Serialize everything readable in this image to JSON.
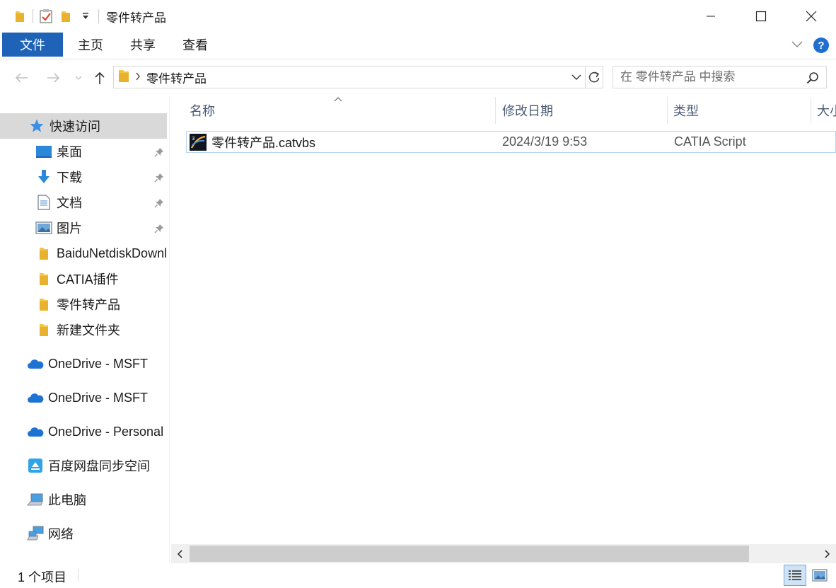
{
  "window": {
    "title": "零件转产品"
  },
  "ribbon": {
    "tabs": [
      "文件",
      "主页",
      "共享",
      "查看"
    ]
  },
  "address": {
    "breadcrumb": [
      "零件转产品"
    ],
    "search_placeholder": "在 零件转产品 中搜索"
  },
  "sidebar": {
    "items": [
      {
        "label": "快速访问",
        "icon": "star-icon"
      },
      {
        "label": "桌面",
        "icon": "desktop-icon",
        "pinned": true
      },
      {
        "label": "下载",
        "icon": "download-icon",
        "pinned": true
      },
      {
        "label": "文档",
        "icon": "document-icon",
        "pinned": true
      },
      {
        "label": "图片",
        "icon": "picture-icon",
        "pinned": true
      },
      {
        "label": "BaiduNetdiskDownload",
        "icon": "folder-icon"
      },
      {
        "label": "CATIA插件",
        "icon": "folder-icon"
      },
      {
        "label": "零件转产品",
        "icon": "folder-icon"
      },
      {
        "label": "新建文件夹",
        "icon": "folder-icon"
      },
      {
        "label": "OneDrive - MSFT",
        "icon": "onedrive-icon"
      },
      {
        "label": "OneDrive - MSFT",
        "icon": "onedrive-icon"
      },
      {
        "label": "OneDrive - Personal",
        "icon": "onedrive-icon"
      },
      {
        "label": "百度网盘同步空间",
        "icon": "baidu-netdisk-icon"
      },
      {
        "label": "此电脑",
        "icon": "computer-icon"
      },
      {
        "label": "网络",
        "icon": "network-icon"
      }
    ]
  },
  "columns": {
    "name": "名称",
    "modified": "修改日期",
    "type": "类型",
    "size": "大小"
  },
  "files": [
    {
      "name": "零件转产品.catvbs",
      "modified": "2024/3/19 9:53",
      "type": "CATIA Script",
      "icon": "catia-script-icon"
    }
  ],
  "status": {
    "item_count": "1 个项目"
  },
  "colors": {
    "file_tab": "#1e63b7",
    "selection_border": "#b8d6ef",
    "active_nav": "#d9d9d9"
  }
}
